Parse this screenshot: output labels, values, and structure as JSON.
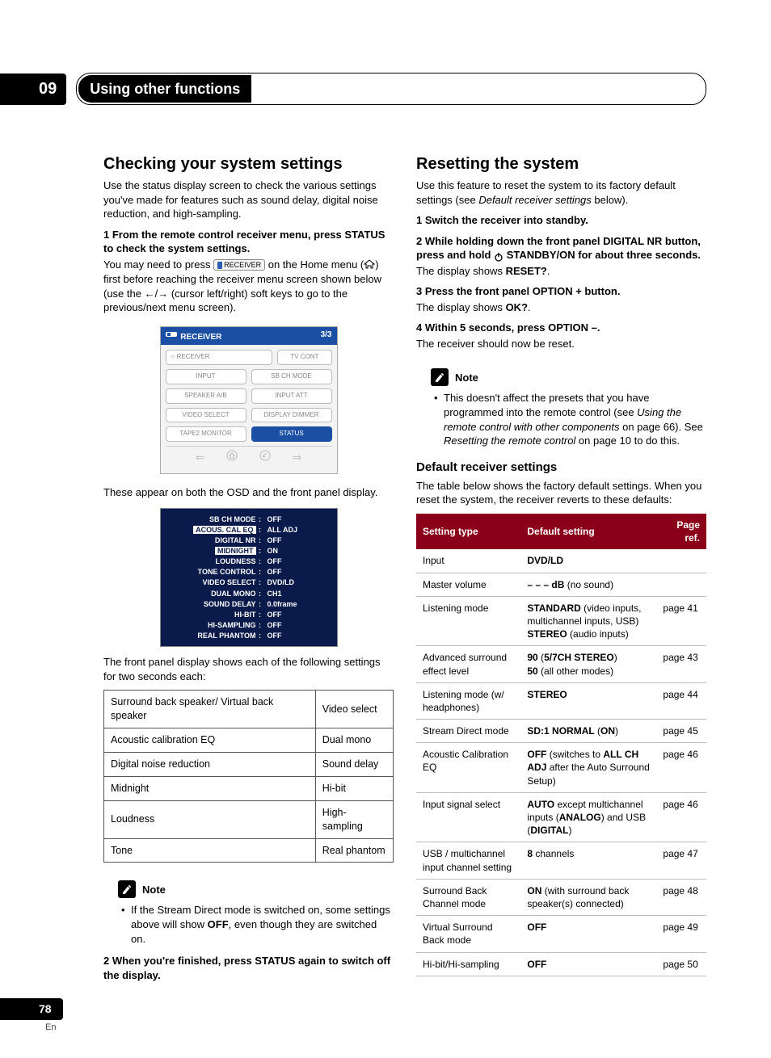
{
  "chapter": {
    "number": "09",
    "title": "Using other functions"
  },
  "left": {
    "h2": "Checking your system settings",
    "intro": "Use the status display screen to check the various settings you've made for features such as sound delay, digital noise reduction, and high-sampling.",
    "step1": "1    From the remote control receiver menu, press STATUS to check the system settings.",
    "step1_sub_pre": "You may need to press ",
    "step1_receiver_btn": "RECEIVER",
    "step1_sub_mid": " on the Home menu (",
    "step1_sub_post": ") first before reaching the receiver menu screen shown below (use the ",
    "step1_sub_post2": " (cursor left/right) soft keys to go to the previous/next menu screen).",
    "osd": {
      "title": "RECEIVER",
      "page": "3/3",
      "cells": [
        [
          "RECEIVER",
          "TV CONT"
        ],
        [
          "INPUT",
          "SB CH MODE"
        ],
        [
          "SPEAKER A/B",
          "INPUT ATT"
        ],
        [
          "VIDEO SELECT",
          "DISPLAY DIMMER"
        ],
        [
          "TAPE2 MONITOR",
          "STATUS"
        ]
      ]
    },
    "after_osd": "These appear on both the OSD and the front panel display.",
    "osd_list": [
      {
        "k": "SB CH MODE",
        "v": "OFF"
      },
      {
        "k": "ACOUS. CAL EQ",
        "v": "ALL ADJ",
        "inv": true
      },
      {
        "k": "DIGITAL NR",
        "v": "OFF"
      },
      {
        "k": "MIDNIGHT",
        "v": "ON",
        "inv": true
      },
      {
        "k": "LOUDNESS",
        "v": "OFF"
      },
      {
        "k": "TONE CONTROL",
        "v": "OFF"
      },
      {
        "k": "VIDEO SELECT",
        "v": "DVD/LD"
      },
      {
        "k": "DUAL MONO",
        "v": "CH1"
      },
      {
        "k": "SOUND DELAY",
        "v": "0.0frame"
      },
      {
        "k": "HI-BIT",
        "v": "OFF"
      },
      {
        "k": "HI-SAMPLING",
        "v": "OFF"
      },
      {
        "k": "REAL PHANTOM",
        "v": "OFF"
      }
    ],
    "after_list": "The front panel display shows each of the following settings for two seconds each:",
    "twocol_table": [
      [
        "Surround back speaker/ Virtual back speaker",
        "Video select"
      ],
      [
        "Acoustic calibration EQ",
        "Dual mono"
      ],
      [
        "Digital noise reduction",
        "Sound delay"
      ],
      [
        "Midnight",
        "Hi-bit"
      ],
      [
        "Loudness",
        "High-sampling"
      ],
      [
        "Tone",
        "Real phantom"
      ]
    ],
    "note_label": "Note",
    "note1_pre": "If the Stream Direct mode is switched on, some settings above will show ",
    "note1_bold": "OFF",
    "note1_post": ", even though they are switched on.",
    "step2": "2    When you're finished, press STATUS again to switch off the display."
  },
  "right": {
    "h2": "Resetting the system",
    "intro_pre": "Use this feature to reset the system to its factory default settings (see ",
    "intro_em": "Default receiver settings",
    "intro_post": " below).",
    "s1": "1    Switch the receiver into standby.",
    "s2_pre": "2    While holding down the front panel DIGITAL NR button, press and hold ",
    "s2_post": " STANDBY/ON for about three seconds.",
    "s2_sub_pre": "The display shows ",
    "s2_sub_bold": "RESET?",
    "s2_sub_post": ".",
    "s3": "3    Press the front panel OPTION + button.",
    "s3_sub_pre": "The display shows ",
    "s3_sub_bold": "OK?",
    "s3_sub_post": ".",
    "s4": "4    Within 5 seconds, press OPTION –.",
    "s4_sub": "The receiver should now be reset.",
    "note_label": "Note",
    "note_a": "This doesn't affect the presets that you have programmed into the remote control (see ",
    "note_a_em": "Using the remote control with other components",
    "note_a_mid": " on page 66). See ",
    "note_a_em2": "Resetting the remote control",
    "note_a_post": " on page 10 to do this.",
    "defaults_h3": "Default receiver settings",
    "defaults_intro": "The table below shows the factory default settings. When you reset the system, the receiver reverts to these defaults:",
    "defaults_header": [
      "Setting type",
      "Default setting",
      "Page ref."
    ],
    "defaults_rows": [
      {
        "t": "Input",
        "d": [
          {
            "b": "DVD/LD"
          }
        ],
        "p": ""
      },
      {
        "t": "Master volume",
        "d": [
          {
            "b": "– – – dB"
          },
          {
            "n": " (no sound)"
          }
        ],
        "p": ""
      },
      {
        "t": "Listening mode",
        "d": [
          {
            "b": "STANDARD"
          },
          {
            "n": " (video inputs, multichannel inputs, USB)"
          },
          {
            "br": true
          },
          {
            "b": "STEREO"
          },
          {
            "n": " (audio inputs)"
          }
        ],
        "p": "page 41"
      },
      {
        "t": "Advanced surround effect level",
        "d": [
          {
            "b": "90"
          },
          {
            "n": " ("
          },
          {
            "b": "5/7CH STEREO"
          },
          {
            "n": ")"
          },
          {
            "br": true
          },
          {
            "b": "50"
          },
          {
            "n": " (all other modes)"
          }
        ],
        "p": "page 43"
      },
      {
        "t": "Listening mode (w/ headphones)",
        "d": [
          {
            "b": "STEREO"
          }
        ],
        "p": "page 44"
      },
      {
        "t": "Stream Direct mode",
        "d": [
          {
            "b": "SD:1 NORMAL"
          },
          {
            "n": " ("
          },
          {
            "b": "ON"
          },
          {
            "n": ")"
          }
        ],
        "p": "page 45"
      },
      {
        "t": "Acoustic Calibration EQ",
        "d": [
          {
            "b": "OFF"
          },
          {
            "n": " (switches to "
          },
          {
            "b": "ALL CH ADJ"
          },
          {
            "n": " after the Auto Surround Setup)"
          }
        ],
        "p": "page 46"
      },
      {
        "t": "Input signal select",
        "d": [
          {
            "b": "AUTO"
          },
          {
            "n": " except multichannel inputs ("
          },
          {
            "b": "ANALOG"
          },
          {
            "n": ") and USB ("
          },
          {
            "b": "DIGITAL"
          },
          {
            "n": ")"
          }
        ],
        "p": "page 46"
      },
      {
        "t": "USB / multichannel input channel setting",
        "d": [
          {
            "b": "8"
          },
          {
            "n": " channels"
          }
        ],
        "p": "page 47"
      },
      {
        "t": "Surround Back Channel mode",
        "d": [
          {
            "b": "ON"
          },
          {
            "n": " (with surround back speaker(s) connected)"
          }
        ],
        "p": "page 48"
      },
      {
        "t": "Virtual Surround Back mode",
        "d": [
          {
            "b": "OFF"
          }
        ],
        "p": "page 49"
      },
      {
        "t": "Hi-bit/Hi-sampling",
        "d": [
          {
            "b": "OFF"
          }
        ],
        "p": "page 50"
      }
    ]
  },
  "footer": {
    "page": "78",
    "lang": "En"
  }
}
